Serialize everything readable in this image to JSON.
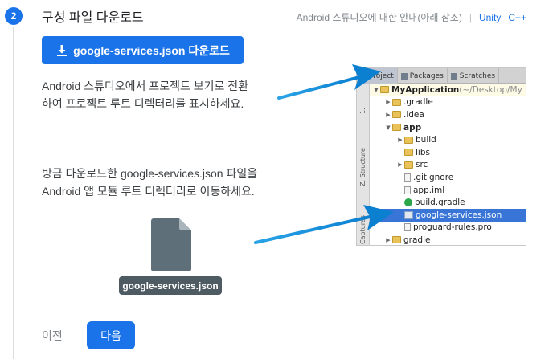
{
  "step": {
    "number": "2",
    "title": "구성 파일 다운로드"
  },
  "guide": {
    "text": "Android 스튜디오에 대한 안내(아래 참조)",
    "separator": "|",
    "links": [
      "Unity",
      "C++"
    ]
  },
  "download_button": {
    "label": "google-services.json 다운로드",
    "icon": "download-icon"
  },
  "instructions": {
    "paragraph1": "Android 스튜디오에서 프로젝트 보기로 전환하여 프로젝트 루트 디렉터리를 표시하세요.",
    "paragraph2": "방금 다운로드한 google-services.json 파일을 Android 앱 모듈 루트 디렉터리로 이동하세요."
  },
  "file_badge": {
    "label": "google-services.json",
    "icon": "file-icon"
  },
  "navigation": {
    "prev_label": "이전",
    "next_label": "다음"
  },
  "ide": {
    "tabs": [
      "Project",
      "Packages",
      "Scratches"
    ],
    "side_labels": [
      "1:",
      "Z: Structure",
      "Captures"
    ],
    "tree": [
      {
        "name": "MyApplication",
        "suffix": "(~/Desktop/My",
        "type": "module",
        "arrow": "down",
        "indent": 0,
        "bold": true
      },
      {
        "name": ".gradle",
        "type": "folder",
        "arrow": "right",
        "indent": 1
      },
      {
        "name": ".idea",
        "type": "folder",
        "arrow": "right",
        "indent": 1
      },
      {
        "name": "app",
        "type": "module",
        "arrow": "down",
        "indent": 1,
        "bold": true
      },
      {
        "name": "build",
        "type": "folder",
        "arrow": "right",
        "indent": 2
      },
      {
        "name": "libs",
        "type": "folder",
        "arrow": "",
        "indent": 2
      },
      {
        "name": "src",
        "type": "folder",
        "arrow": "right",
        "indent": 2
      },
      {
        "name": ".gitignore",
        "type": "file",
        "arrow": "",
        "indent": 2
      },
      {
        "name": "app.iml",
        "type": "file",
        "arrow": "",
        "indent": 2
      },
      {
        "name": "build.gradle",
        "type": "gradle",
        "arrow": "",
        "indent": 2
      },
      {
        "name": "google-services.json",
        "type": "json",
        "arrow": "",
        "indent": 2,
        "selected": true
      },
      {
        "name": "proguard-rules.pro",
        "type": "file",
        "arrow": "",
        "indent": 2
      },
      {
        "name": "gradle",
        "type": "folder",
        "arrow": "right",
        "indent": 1
      }
    ]
  },
  "colors": {
    "primary": "#1a73e8",
    "arrow": "#1a9be0",
    "file_badge": "#4f5b62",
    "selection": "#3875d7"
  }
}
